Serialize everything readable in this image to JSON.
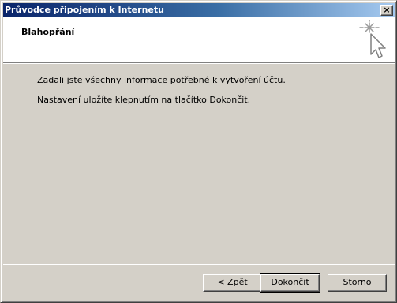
{
  "window": {
    "title": "Průvodce připojením k Internetu",
    "close_label": "×"
  },
  "header": {
    "title": "Blahopřání",
    "icon": "wizard-sparkle-cursor-icon"
  },
  "body": {
    "line1": "Zadali jste všechny informace potřebné k vytvoření účtu.",
    "line2": "Nastavení uložíte klepnutím na tlačítko Dokončit."
  },
  "buttons": {
    "back": "< Zpět",
    "finish": "Dokončit",
    "cancel": "Storno"
  },
  "colors": {
    "titlebar_start": "#0a246a",
    "titlebar_end": "#a6caf0",
    "face": "#d4d0c8"
  }
}
